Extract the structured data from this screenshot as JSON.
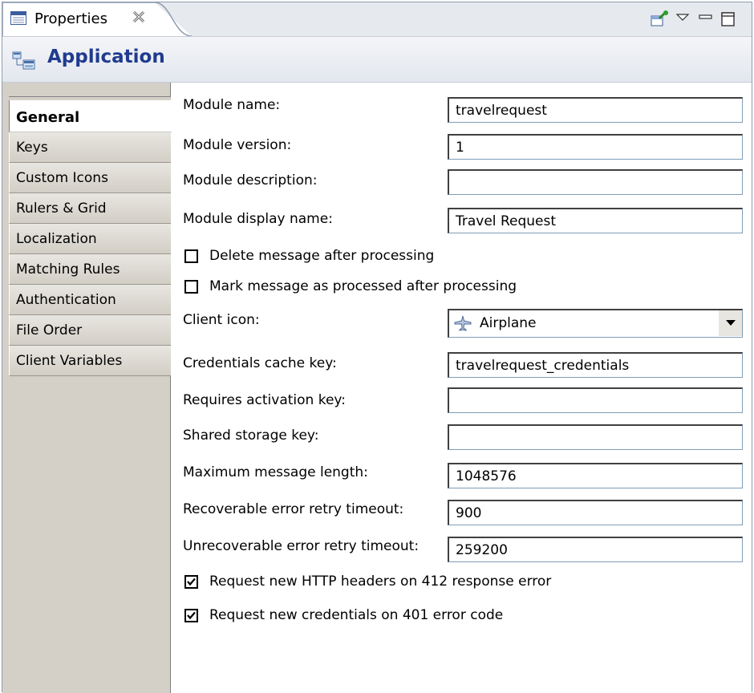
{
  "view_tab": {
    "label": "Properties"
  },
  "header": {
    "title": "Application"
  },
  "sidebar": {
    "items": [
      {
        "label": "General",
        "active": true
      },
      {
        "label": "Keys"
      },
      {
        "label": "Custom Icons"
      },
      {
        "label": "Rulers & Grid"
      },
      {
        "label": "Localization"
      },
      {
        "label": "Matching Rules"
      },
      {
        "label": "Authentication"
      },
      {
        "label": "File Order"
      },
      {
        "label": "Client Variables"
      }
    ]
  },
  "form": {
    "module_name": {
      "label": "Module name:",
      "value": "travelrequest"
    },
    "module_version": {
      "label": "Module version:",
      "value": "1"
    },
    "module_description": {
      "label": "Module description:",
      "value": ""
    },
    "module_display_name": {
      "label": "Module display name:",
      "value": "Travel Request"
    },
    "delete_message": {
      "label": "Delete message after processing",
      "checked": false
    },
    "mark_message": {
      "label": "Mark message as processed after processing",
      "checked": false
    },
    "client_icon": {
      "label": "Client icon:",
      "value": "Airplane",
      "icon": "airplane-icon"
    },
    "credentials_cache_key": {
      "label": "Credentials cache key:",
      "value": "travelrequest_credentials"
    },
    "requires_activation_key": {
      "label": "Requires activation key:",
      "value": ""
    },
    "shared_storage_key": {
      "label": "Shared storage key:",
      "value": ""
    },
    "max_message_length": {
      "label": "Maximum message length:",
      "value": "1048576"
    },
    "recoverable_timeout": {
      "label": "Recoverable error retry timeout:",
      "value": "900"
    },
    "unrecoverable_timeout": {
      "label": "Unrecoverable error retry timeout:",
      "value": "259200"
    },
    "request_http_headers": {
      "label": "Request new HTTP headers on 412 response error",
      "checked": true
    },
    "request_credentials": {
      "label": "Request new credentials on 401 error code",
      "checked": true
    }
  }
}
